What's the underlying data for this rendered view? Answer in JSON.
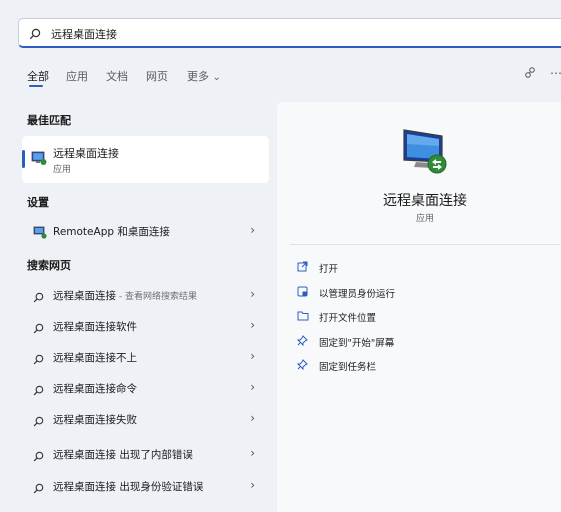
{
  "search": {
    "value": "远程桌面连接"
  },
  "tabs": [
    {
      "label": "全部"
    },
    {
      "label": "应用"
    },
    {
      "label": "文档"
    },
    {
      "label": "网页"
    },
    {
      "label": "更多"
    }
  ],
  "more_chevron": "⌄",
  "top_icons": [
    "share-icon",
    "more-options-icon"
  ],
  "sections": {
    "best_match": "最佳匹配",
    "settings": "设置",
    "web": "搜索网页"
  },
  "best_match": {
    "title": "远程桌面连接",
    "subtitle": "应用"
  },
  "settings_items": [
    {
      "label": "RemoteApp 和桌面连接"
    }
  ],
  "web_results": [
    {
      "label": "远程桌面连接",
      "suffix": " - 查看网络搜索结果"
    },
    {
      "label": "远程桌面连接软件",
      "suffix": ""
    },
    {
      "label": "远程桌面连接不上",
      "suffix": ""
    },
    {
      "label": "远程桌面连接命令",
      "suffix": ""
    },
    {
      "label": "远程桌面连接失败",
      "suffix": ""
    },
    {
      "label": "远程桌面连接 出现了内部错误",
      "suffix": ""
    },
    {
      "label": "远程桌面连接 出现身份验证错误",
      "suffix": ""
    }
  ],
  "detail": {
    "title": "远程桌面连接",
    "type": "应用",
    "actions": [
      {
        "label": "打开",
        "icon": "open-icon"
      },
      {
        "label": "以管理员身份运行",
        "icon": "admin-shield-icon"
      },
      {
        "label": "打开文件位置",
        "icon": "folder-icon"
      },
      {
        "label": "固定到\"开始\"屏幕",
        "icon": "pin-icon"
      },
      {
        "label": "固定到任务栏",
        "icon": "pin-icon"
      }
    ]
  },
  "colors": {
    "accent": "#2b5fbf",
    "background": "#eef1f6",
    "panel": "#f8f9fb"
  }
}
